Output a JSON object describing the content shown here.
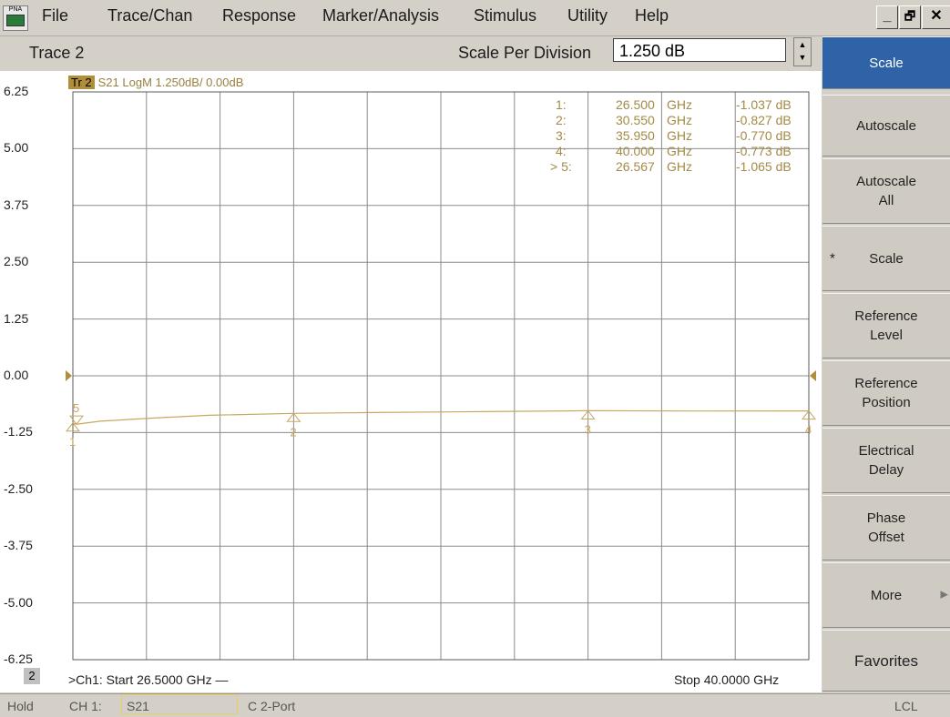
{
  "app_icon_label": "PNA",
  "menu": [
    "File",
    "Trace/Chan",
    "Response",
    "Marker/Analysis",
    "Stimulus",
    "Utility",
    "Help"
  ],
  "window_controls": {
    "minimize": "_",
    "restore": "🗗",
    "close": "✕"
  },
  "toolbar": {
    "trace_title": "Trace 2",
    "scale_label": "Scale Per Division",
    "scale_value": "1.250 dB"
  },
  "trace_tag": {
    "box": "Tr  2",
    "text": "S21 LogM 1.250dB/  0.00dB"
  },
  "markers_table": [
    {
      "id": "1:",
      "freq": "26.500",
      "unit": "GHz",
      "value": "-1.037 dB"
    },
    {
      "id": "2:",
      "freq": "30.550",
      "unit": "GHz",
      "value": "-0.827 dB"
    },
    {
      "id": "3:",
      "freq": "35.950",
      "unit": "GHz",
      "value": "-0.770 dB"
    },
    {
      "id": "4:",
      "freq": "40.000",
      "unit": "GHz",
      "value": "-0.773 dB"
    },
    {
      "id": "> 5:",
      "freq": "26.567",
      "unit": "GHz",
      "value": "-1.065 dB"
    }
  ],
  "chart_data": {
    "type": "line",
    "y_tick_labels": [
      "6.25",
      "5.00",
      "3.75",
      "2.50",
      "1.25",
      "0.00",
      "-1.25",
      "-2.50",
      "-3.75",
      "-5.00",
      "-6.25"
    ],
    "ylim": [
      -6.25,
      6.25
    ],
    "xlim": [
      26.5,
      40.0
    ],
    "reference_level": 0.0,
    "grid": true,
    "series": [
      {
        "x": [
          26.5,
          26.567,
          27.0,
          28.0,
          29.0,
          30.55,
          32.0,
          34.0,
          35.95,
          38.0,
          40.0
        ],
        "y": [
          -1.037,
          -1.065,
          -1.0,
          -0.93,
          -0.87,
          -0.827,
          -0.81,
          -0.79,
          -0.77,
          -0.775,
          -0.773
        ],
        "color": "#c8a860"
      }
    ],
    "markers": [
      {
        "label": "1",
        "x": 26.5,
        "y": -1.037
      },
      {
        "label": "2",
        "x": 30.55,
        "y": -0.827
      },
      {
        "label": "3",
        "x": 35.95,
        "y": -0.77
      },
      {
        "label": "4",
        "x": 40.0,
        "y": -0.773
      },
      {
        "label": "5",
        "x": 26.567,
        "y": -1.065
      }
    ]
  },
  "footer": {
    "channel_badge": "2",
    "start": ">Ch1: Start  26.5000 GHz —",
    "stop": "Stop  40.0000 GHz"
  },
  "softkeys": [
    {
      "label": "Scale",
      "active": true
    },
    {
      "label": "Autoscale"
    },
    {
      "label": "Autoscale\nAll"
    },
    {
      "label": "Scale",
      "star": "*"
    },
    {
      "label": "Reference\nLevel"
    },
    {
      "label": "Reference\nPosition"
    },
    {
      "label": "Electrical\nDelay"
    },
    {
      "label": "Phase\nOffset"
    },
    {
      "label": "More",
      "arrow": "▶"
    },
    {
      "label": "Favorites"
    }
  ],
  "statusbar": {
    "mode": "Hold",
    "channel": "CH 1:",
    "measurement": "S21",
    "cal": "C  2-Port",
    "remote": "LCL"
  }
}
